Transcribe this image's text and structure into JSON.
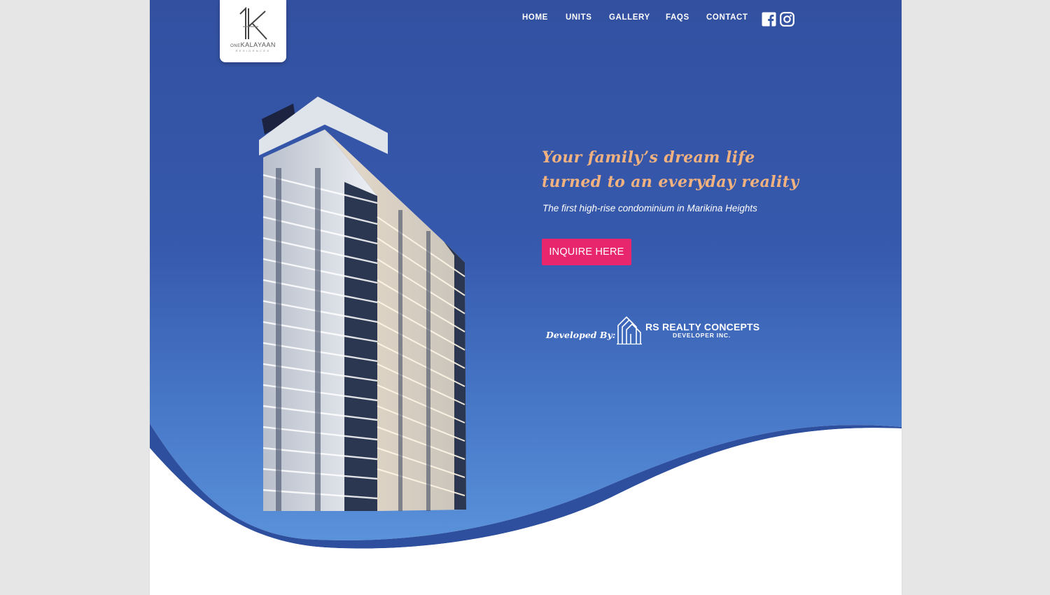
{
  "brand": {
    "logo_name_small": "ONE",
    "logo_name": "KALAYAAN",
    "logo_subtitle": "RESIDENCES"
  },
  "nav": {
    "home": "HOME",
    "units": "UNITS",
    "gallery": "GALLERY",
    "faqs": "FAQS",
    "contact": "CONTACT"
  },
  "social": [
    "facebook-icon",
    "instagram-icon"
  ],
  "hero": {
    "headline_line1": "Your family’s dream life",
    "headline_line2": "turned to an everyday reality",
    "subheadline": "The first high-rise condominium in Marikina Heights",
    "cta": "INQUIRE HERE"
  },
  "developer": {
    "label": "Developed By:",
    "name": "RS REALTY CONCEPTS",
    "subname": "DEVELOPER INC."
  },
  "colors": {
    "hero_blue": "#3555a3",
    "wave_blue": "#2d4f9e",
    "headline_peach": "#f2b280",
    "cta_pink": "#e8266d",
    "background": "#e6e6e6"
  }
}
